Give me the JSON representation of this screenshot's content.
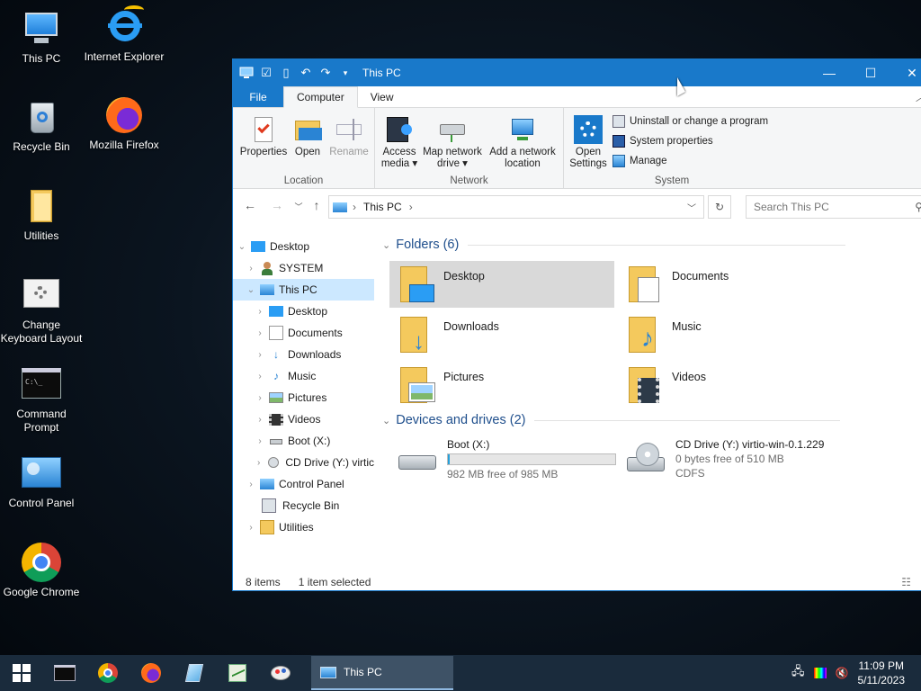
{
  "desktop": {
    "icons": [
      {
        "label": "This PC"
      },
      {
        "label": "Internet Explorer"
      },
      {
        "label": "Recycle Bin"
      },
      {
        "label": "Mozilla Firefox"
      },
      {
        "label": "Utilities"
      },
      {
        "label": "Change Keyboard Layout"
      },
      {
        "label": "Command Prompt"
      },
      {
        "label": "Control Panel"
      },
      {
        "label": "Google Chrome"
      }
    ]
  },
  "window": {
    "title": "This PC",
    "tabs": {
      "file": "File",
      "computer": "Computer",
      "view": "View"
    },
    "ribbon": {
      "location": {
        "label": "Location",
        "properties": "Properties",
        "open": "Open",
        "rename": "Rename"
      },
      "network": {
        "label": "Network",
        "access_media": "Access media ▾",
        "map_drive": "Map network drive ▾",
        "add_location": "Add a network location"
      },
      "system": {
        "label": "System",
        "open_settings": "Open Settings",
        "uninstall": "Uninstall or change a program",
        "properties": "System properties",
        "manage": "Manage"
      }
    },
    "address": {
      "path": "This PC",
      "search_placeholder": "Search This PC"
    },
    "tree": [
      {
        "label": "Desktop"
      },
      {
        "label": "SYSTEM"
      },
      {
        "label": "This PC"
      },
      {
        "label": "Desktop"
      },
      {
        "label": "Documents"
      },
      {
        "label": "Downloads"
      },
      {
        "label": "Music"
      },
      {
        "label": "Pictures"
      },
      {
        "label": "Videos"
      },
      {
        "label": "Boot (X:)"
      },
      {
        "label": "CD Drive (Y:) virtic"
      },
      {
        "label": "Control Panel"
      },
      {
        "label": "Recycle Bin"
      },
      {
        "label": "Utilities"
      }
    ],
    "folders_header": "Folders (6)",
    "folders": [
      {
        "name": "Desktop"
      },
      {
        "name": "Documents"
      },
      {
        "name": "Downloads"
      },
      {
        "name": "Music"
      },
      {
        "name": "Pictures"
      },
      {
        "name": "Videos"
      }
    ],
    "drives_header": "Devices and drives (2)",
    "drives": [
      {
        "name": "Boot (X:)",
        "free": "982 MB free of 985 MB",
        "used_fraction": 0.003
      },
      {
        "name": "CD Drive (Y:) virtio-win-0.1.229",
        "free": "0 bytes free of 510 MB",
        "fs": "CDFS"
      }
    ],
    "status": {
      "items": "8 items",
      "selected": "1 item selected"
    }
  },
  "taskbar": {
    "active_app": "This PC",
    "time": "11:09 PM",
    "date": "5/11/2023"
  },
  "colors": {
    "accent": "#1979ca",
    "selection": "#cce8ff",
    "folder": "#f4c95d",
    "taskbar": "#1a2b3c"
  }
}
